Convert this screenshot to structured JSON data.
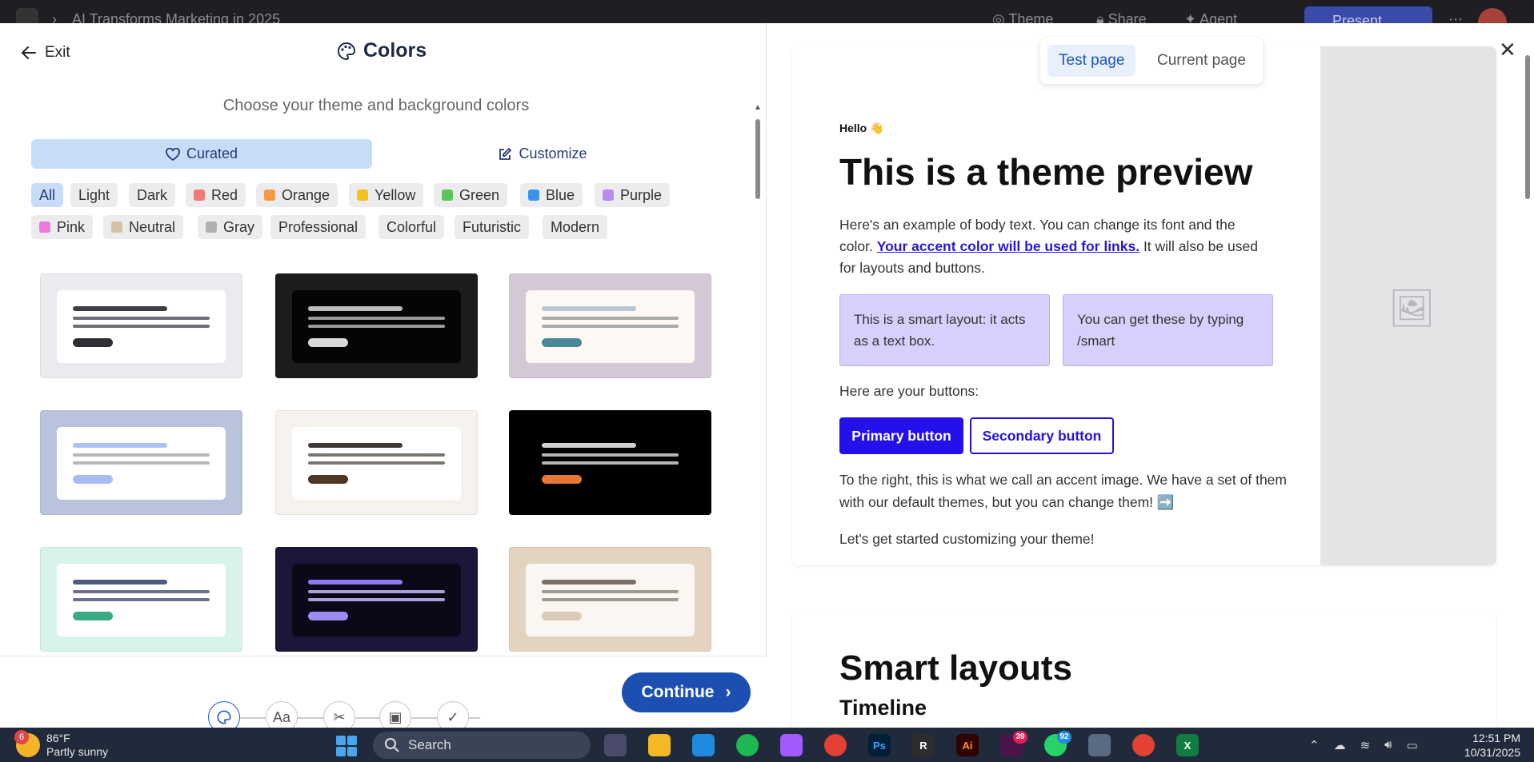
{
  "topbar": {
    "doc_title": "AI Transforms Marketing in 2025",
    "theme_label": "Theme",
    "share_label": "Share",
    "agent_label": "Agent",
    "present_label": "Present"
  },
  "panel": {
    "exit_label": "Exit",
    "title": "Colors",
    "subtitle": "Choose your theme and background colors",
    "segments": [
      {
        "label": "Curated",
        "icon": "heart-icon",
        "active": true
      },
      {
        "label": "Customize",
        "icon": "edit-icon",
        "active": false
      }
    ],
    "filters": [
      {
        "label": "All",
        "active": true
      },
      {
        "label": "Light"
      },
      {
        "label": "Dark"
      },
      {
        "label": "Red",
        "swatch": "#f07a7a"
      },
      {
        "label": "Orange",
        "swatch": "#f59a45"
      },
      {
        "label": "Yellow",
        "swatch": "#f3c21b"
      },
      {
        "label": "Green",
        "swatch": "#5cc45c"
      },
      {
        "label": "Blue",
        "swatch": "#3794e6"
      },
      {
        "label": "Purple",
        "swatch": "#b98cf0"
      },
      {
        "label": "Pink",
        "swatch": "#ee7ad7"
      },
      {
        "label": "Neutral",
        "swatch": "#d6c2a3"
      },
      {
        "label": "Gray",
        "swatch": "#b0b0b0"
      },
      {
        "label": "Professional"
      },
      {
        "label": "Colorful"
      },
      {
        "label": "Futuristic"
      },
      {
        "label": "Modern"
      }
    ],
    "themes": [
      {
        "bg": "#ebebef",
        "inner": "#ffffff",
        "line1": "#3d3d45",
        "lines": "#6e6e76",
        "btn": "#2f2f36"
      },
      {
        "bg": "#1c1c1c",
        "inner": "#050505",
        "line1": "#bdbdbd",
        "lines": "#9a9a9a",
        "btn": "#d9d9d9"
      },
      {
        "bg": "#d4c8d6",
        "inner": "#fdf8f3",
        "line1": "#b8c8d3",
        "lines": "#a8a8a8",
        "btn": "#4a8a98"
      },
      {
        "bg": "#b9c4dc",
        "inner": "#ffffff",
        "line1": "#aec2f2",
        "lines": "#b8b8b8",
        "btn": "#a9bbf3"
      },
      {
        "bg": "#f6f2ed",
        "inner": "#ffffff",
        "line1": "#3f3a37",
        "lines": "#7a7570",
        "btn": "#4d3726"
      },
      {
        "bg": "#000000",
        "inner": "#000000",
        "line1": "#d0d0d0",
        "lines": "#b5b5b5",
        "btn": "#e77734"
      },
      {
        "bg": "#d8f3ea",
        "inner": "#ffffff",
        "line1": "#4d5a80",
        "lines": "#6a7290",
        "btn": "#3aaa86"
      },
      {
        "bg": "#1d1638",
        "inner": "#0b0818",
        "line1": "#8d7af0",
        "lines": "#a89fd6",
        "btn": "#9f8cf2"
      },
      {
        "bg": "#e2d4c0",
        "inner": "#faf6f1",
        "line1": "#7a7068",
        "lines": "#a09a92",
        "btn": "#d9cbb8"
      }
    ],
    "continue_label": "Continue",
    "steps": [
      "palette-icon",
      "typography-icon",
      "tools-icon",
      "image-icon",
      "check-icon"
    ],
    "step_labels": {
      "typography": "Aa"
    }
  },
  "preview": {
    "tabs": [
      {
        "label": "Test page",
        "active": true
      },
      {
        "label": "Current page"
      }
    ],
    "hello": "Hello 👋",
    "heading": "This is a theme preview",
    "body_pre": "Here's an example of body text. You can change its font and the color. ",
    "body_link": "Your accent color will be used for links.",
    "body_post": " It will also be used for layouts and buttons.",
    "smart_box_1": "This is a smart layout: it acts as a text box.",
    "smart_box_2": "You can get these by typing /smart",
    "buttons_label": "Here are your buttons:",
    "primary_button": "Primary button",
    "secondary_button": "Secondary button",
    "accent_text": "To the right, this is what we call an accent image. We have a set of them with our default themes, but you can change them! ➡️",
    "start_text": "Let's get started customizing your theme!",
    "section2_title": "Smart layouts",
    "section2_sub": "Timeline"
  },
  "taskbar": {
    "weather_temp": "86°F",
    "weather_desc": "Partly sunny",
    "weather_badge": "6",
    "search_label": "Search",
    "slack_badge": "39",
    "whatsapp_badge": "92",
    "time": "12:51 PM",
    "date": "10/31/2025"
  }
}
